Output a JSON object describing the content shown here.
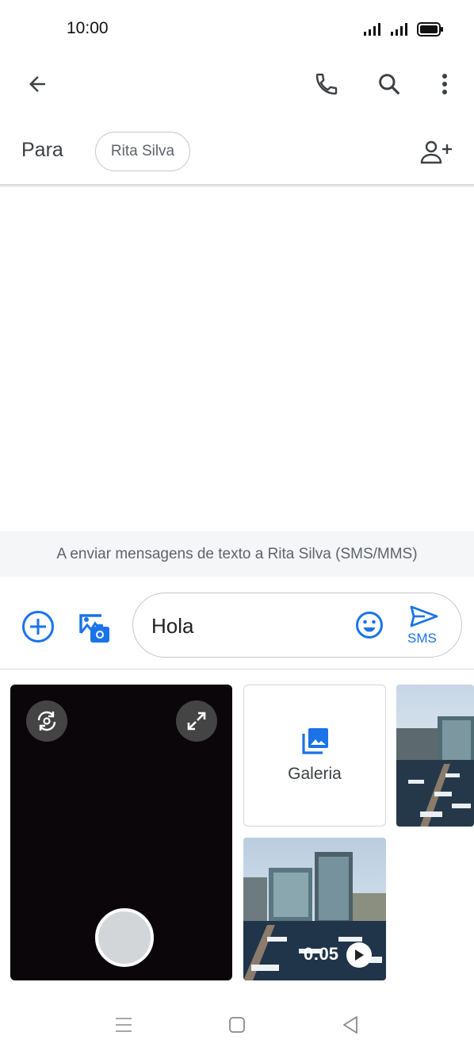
{
  "status_bar": {
    "time": "10:00"
  },
  "recipient": {
    "to_label": "Para",
    "chip_name": "Rita Silva"
  },
  "info_banner": "A enviar mensagens de texto a Rita Silva (SMS/MMS)",
  "compose": {
    "text": "Hola",
    "send_label": "SMS"
  },
  "media": {
    "gallery_label": "Galeria",
    "video_duration": "0:05"
  },
  "colors": {
    "accent": "#1a73e8",
    "camera_bg": "#0b0609"
  },
  "icons": [
    "back-arrow-icon",
    "phone-icon",
    "search-icon",
    "more-vert-icon",
    "add-person-icon",
    "add-circle-icon",
    "gallery-camera-icon",
    "emoji-icon",
    "send-icon",
    "flip-camera-icon",
    "fullscreen-icon",
    "gallery-icon",
    "play-icon",
    "menu-nav-icon",
    "home-nav-icon",
    "back-nav-icon"
  ]
}
